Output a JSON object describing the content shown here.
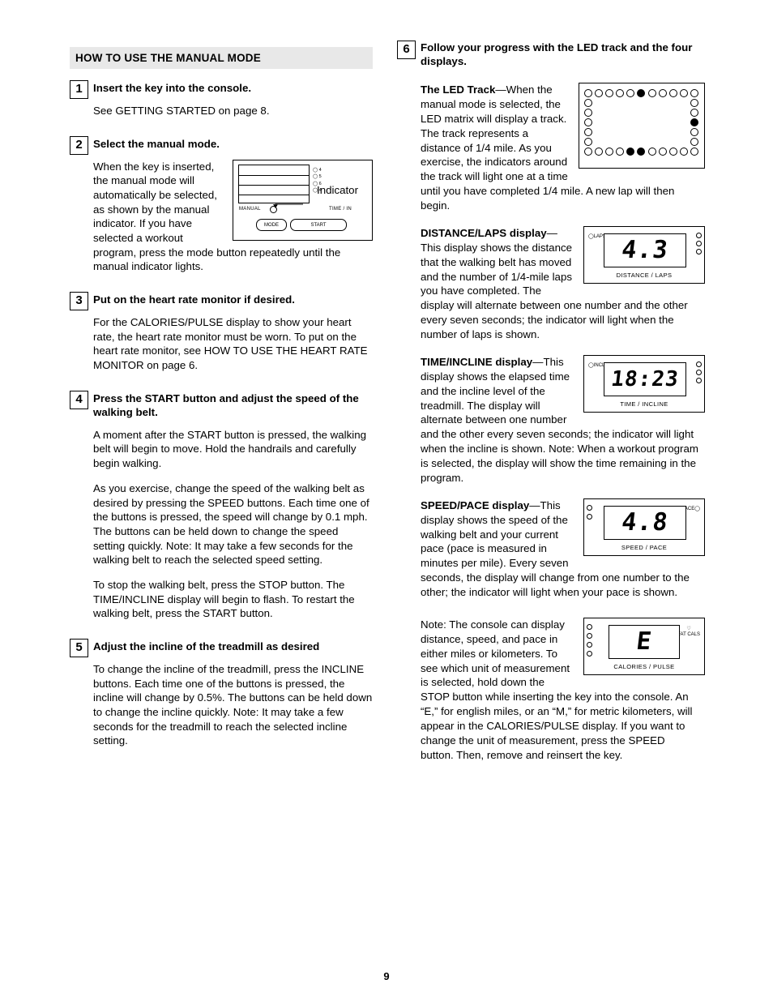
{
  "document": {
    "page_number": "9"
  },
  "left_column": {
    "section_header": "HOW TO USE THE MANUAL MODE",
    "steps": [
      {
        "number": "1",
        "title": "Insert the key into the console.",
        "paragraphs": [
          "See GETTING STARTED on page 8."
        ]
      },
      {
        "number": "2",
        "title": "Select the manual mode.",
        "paragraphs": [
          "When the key is inserted, the manual mode will automatically be selected, as shown by the manual indicator. If you have selected a workout program, press the mode button repeatedly until the manual indicator lights."
        ]
      },
      {
        "number": "3",
        "title": "Put on the heart rate monitor if desired.",
        "paragraphs": [
          "For the CALORIES/PULSE display to show your heart rate, the heart rate monitor must be worn. To put on the heart rate monitor, see HOW TO USE THE HEART RATE MONITOR on page 6."
        ]
      },
      {
        "number": "4",
        "title": "Press the START button and adjust the speed of the walking belt.",
        "paragraphs": [
          "A moment after the START button is pressed, the walking belt will begin to move. Hold the handrails and carefully begin walking.",
          "As you exercise, change the speed of the walking belt as desired by pressing the SPEED buttons. Each time one of the buttons is pressed, the speed will change by 0.1 mph. The buttons can be held down to change the speed setting quickly. Note: It may take a few seconds for the walking belt to reach the selected speed setting.",
          "To stop the walking belt, press the STOP button. The TIME/INCLINE display will begin to flash. To restart the walking belt, press the START button."
        ]
      },
      {
        "number": "5",
        "title": "Adjust the incline of the treadmill as desired",
        "paragraphs": [
          "To change the incline of the treadmill, press the INCLINE buttons. Each time one of the buttons is pressed, the incline will change by 0.5%. The buttons can be held down to change the incline quickly. Note: It may take a few seconds for the treadmill to reach the selected incline setting."
        ]
      }
    ],
    "console_figure": {
      "indicator_label": "Indicator",
      "manual_label": "MANUAL",
      "time_label": "TIME / IN",
      "mode_button": "MODE",
      "start_button": "START",
      "lamp_labels": [
        "4",
        "5",
        "6",
        "4"
      ]
    }
  },
  "right_column": {
    "step": {
      "number": "6",
      "title": "Follow your progress with the LED track and the four displays."
    },
    "blocks": [
      {
        "lead": "The LED Track",
        "lead_sep": "—When",
        "text": "the manual mode is selected, the LED matrix will display a track. The track represents a distance of 1/4 mile. As you exercise, the indicators around the track will light one at a time until you have completed 1/4 mile. A new lap will then begin."
      },
      {
        "lead": "DISTANCE/LAPS display",
        "lead_sep": "—This display",
        "text": "shows the distance that the walking belt has moved and the number of 1/4-mile laps you have completed. The display will alternate between one number and the other every seven seconds; the indicator will light when the number of laps is shown."
      },
      {
        "lead": "TIME/INCLINE display",
        "lead_sep": "—This display",
        "text": "shows the elapsed time and the incline level of the treadmill. The display will alternate between one number and the other every seven seconds; the indicator will light when the incline is shown. Note: When a workout program is selected, the display will show the time remaining in the program."
      },
      {
        "lead": "SPEED/PACE display",
        "lead_sep": "—This display",
        "text": "shows the speed of the walking belt and your current pace (pace is measured in minutes per mile). Every seven seconds, the display will change from one number to the other; the indicator will light when your pace is shown."
      },
      {
        "lead": "",
        "lead_sep": "",
        "text": "Note: The console can display distance, speed, and pace in either miles or kilometers. To see which unit of measurement is selected, hold down the STOP button while inserting the key into the console. An “E,” for english miles, or an “M,” for metric kilometers, will appear in the CALORIES/PULSE display. If you want to change the unit of measurement, press the SPEED   button. Then, remove and reinsert the key."
      }
    ],
    "displays": [
      {
        "name": "distance-laps-display",
        "value": "4.3",
        "caption": "DISTANCE / LAPS",
        "indicator": "LAPS"
      },
      {
        "name": "time-incline-display",
        "value": "18:23",
        "caption": "TIME / INCLINE",
        "indicator": "INCL."
      },
      {
        "name": "speed-pace-display",
        "value": "4.8",
        "caption": "SPEED / PACE",
        "indicator": "PACE"
      },
      {
        "name": "calories-pulse-display",
        "value": "E",
        "caption": "CALORIES / PULSE",
        "indicator": "FAT CALS"
      }
    ],
    "led_track": {
      "rows": 7,
      "cols": 11,
      "lit_cells": [
        [
          0,
          5
        ],
        [
          3,
          10
        ],
        [
          6,
          5
        ],
        [
          6,
          4
        ]
      ]
    }
  }
}
